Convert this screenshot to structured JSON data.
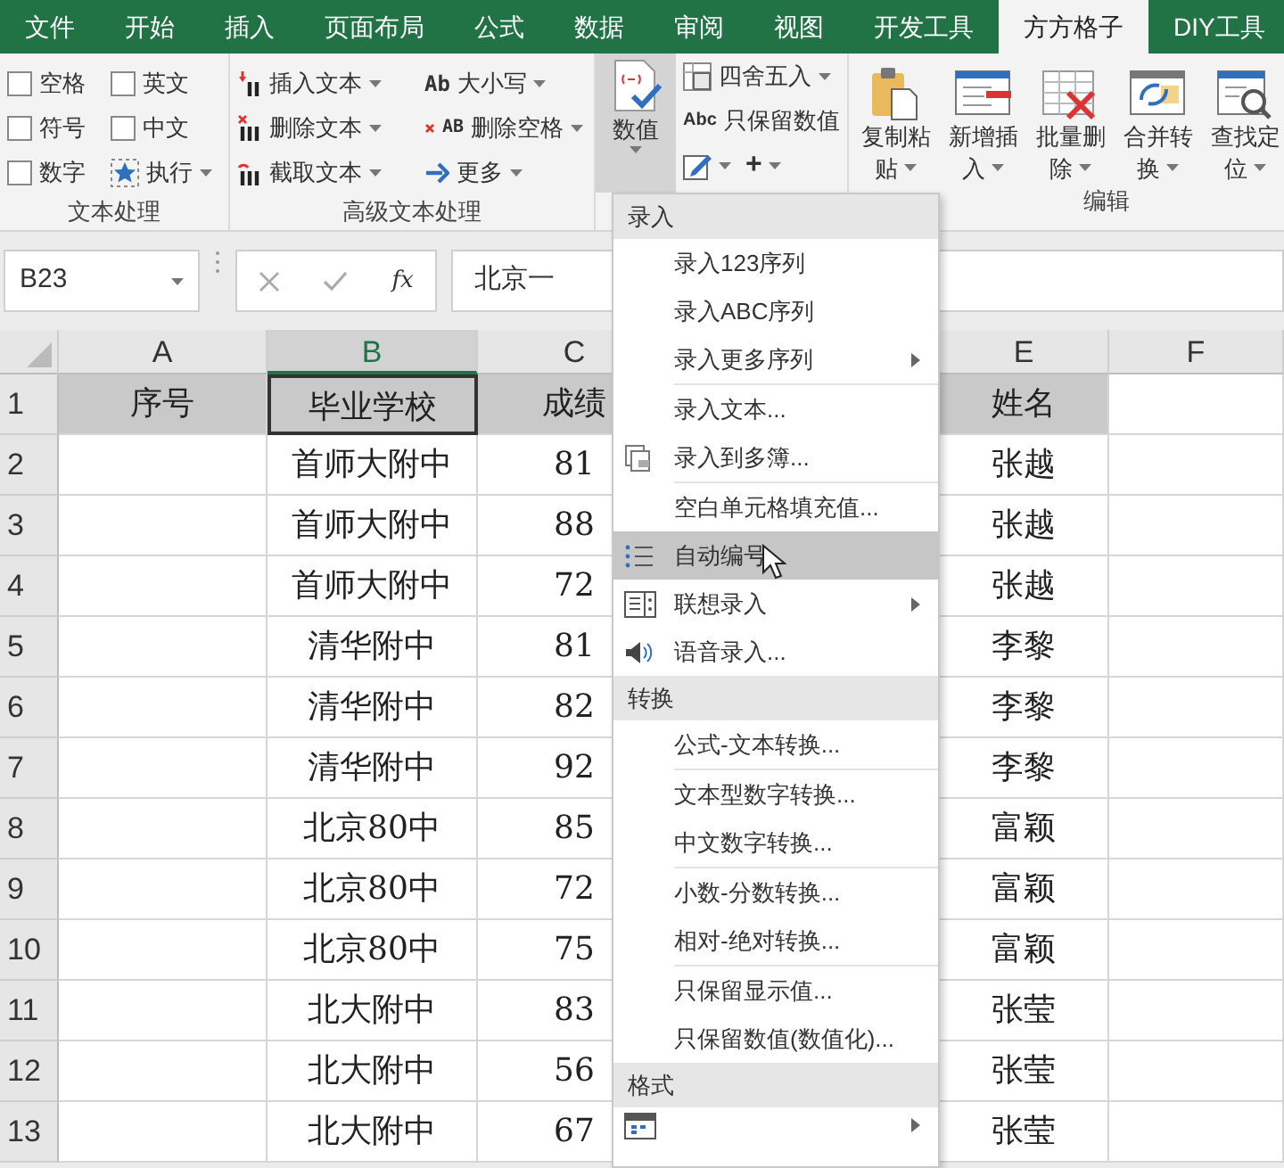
{
  "tabs": [
    {
      "label": "文件",
      "selected": false
    },
    {
      "label": "开始",
      "selected": false
    },
    {
      "label": "插入",
      "selected": false
    },
    {
      "label": "页面布局",
      "selected": false
    },
    {
      "label": "公式",
      "selected": false
    },
    {
      "label": "数据",
      "selected": false
    },
    {
      "label": "审阅",
      "selected": false
    },
    {
      "label": "视图",
      "selected": false
    },
    {
      "label": "开发工具",
      "selected": false
    },
    {
      "label": "方方格子",
      "selected": true
    },
    {
      "label": "DIY工具",
      "selected": false
    }
  ],
  "ribbon": {
    "text_group": {
      "label": "文本处理",
      "checkboxes": [
        {
          "label": "空格",
          "checked": false
        },
        {
          "label": "英文",
          "checked": false
        },
        {
          "label": "符号",
          "checked": false
        },
        {
          "label": "中文",
          "checked": false
        },
        {
          "label": "数字",
          "checked": false
        }
      ],
      "execute": "执行"
    },
    "advanced_group": {
      "label": "高级文本处理",
      "buttons": [
        {
          "label": "插入文本"
        },
        {
          "label": "大小写",
          "icon_text": "Ab"
        },
        {
          "label": "删除文本"
        },
        {
          "label": "删除空格",
          "icon_text": "AB"
        },
        {
          "label": "截取文本"
        },
        {
          "label": "更多"
        }
      ]
    },
    "number_group": {
      "button": "数值",
      "pressed": true,
      "round": "四舍五入",
      "keep": "只保留数值",
      "keep_icon_text": "Abc",
      "plus": "+"
    },
    "edit_group": {
      "label": "编辑",
      "buttons": [
        {
          "lines": [
            "复制粘",
            "贴"
          ]
        },
        {
          "lines": [
            "新增插",
            "入"
          ]
        },
        {
          "lines": [
            "批量删",
            "除"
          ]
        },
        {
          "lines": [
            "合并转",
            "换"
          ]
        },
        {
          "lines": [
            "查找定",
            "位"
          ]
        }
      ]
    }
  },
  "formula_bar": {
    "name_box": "B23",
    "fx": "fx",
    "value": "北京一"
  },
  "grid": {
    "columns": [
      {
        "label": "A",
        "selected": false
      },
      {
        "label": "B",
        "selected": true
      },
      {
        "label": "C",
        "selected": false
      },
      {
        "label": "E",
        "selected": false
      },
      {
        "label": "F",
        "selected": false
      }
    ],
    "rows": [
      {
        "number": "1",
        "header": true,
        "cells": [
          "序号",
          "毕业学校",
          "成绩",
          "姓名",
          null
        ]
      },
      {
        "number": "2",
        "header": false,
        "cells": [
          null,
          "首师大附中",
          "81",
          "张越",
          null
        ]
      },
      {
        "number": "3",
        "header": false,
        "cells": [
          null,
          "首师大附中",
          "88",
          "张越",
          null
        ]
      },
      {
        "number": "4",
        "header": false,
        "cells": [
          null,
          "首师大附中",
          "72",
          "张越",
          null
        ]
      },
      {
        "number": "5",
        "header": false,
        "cells": [
          null,
          "清华附中",
          "81",
          "李黎",
          null
        ]
      },
      {
        "number": "6",
        "header": false,
        "cells": [
          null,
          "清华附中",
          "82",
          "李黎",
          null
        ]
      },
      {
        "number": "7",
        "header": false,
        "cells": [
          null,
          "清华附中",
          "92",
          "李黎",
          null
        ]
      },
      {
        "number": "8",
        "header": false,
        "cells": [
          null,
          "北京80中",
          "85",
          "富颖",
          null
        ]
      },
      {
        "number": "9",
        "header": false,
        "cells": [
          null,
          "北京80中",
          "72",
          "富颖",
          null
        ]
      },
      {
        "number": "10",
        "header": false,
        "cells": [
          null,
          "北京80中",
          "75",
          "富颖",
          null
        ]
      },
      {
        "number": "11",
        "header": false,
        "cells": [
          null,
          "北大附中",
          "83",
          "张莹",
          null
        ]
      },
      {
        "number": "12",
        "header": false,
        "cells": [
          null,
          "北大附中",
          "56",
          "张莹",
          null
        ]
      },
      {
        "number": "13",
        "header": false,
        "cells": [
          null,
          "北大附中",
          "67",
          "张莹",
          null
        ]
      }
    ]
  },
  "menu": {
    "sections": [
      {
        "title": "录入",
        "items": [
          {
            "kind": "item",
            "label": "录入123序列",
            "submenu": false,
            "selected": false
          },
          {
            "kind": "item",
            "label": "录入ABC序列",
            "submenu": false,
            "selected": false
          },
          {
            "kind": "item",
            "label": "录入更多序列",
            "submenu": true,
            "selected": false
          },
          {
            "kind": "separator"
          },
          {
            "kind": "item",
            "label": "录入文本...",
            "submenu": false,
            "selected": false
          },
          {
            "kind": "copy",
            "label": "录入到多簿...",
            "submenu": false,
            "selected": false
          },
          {
            "kind": "separator"
          },
          {
            "kind": "item",
            "label": "空白单元格填充值...",
            "submenu": false,
            "selected": false
          },
          {
            "kind": "list",
            "label": "自动编号",
            "submenu": false,
            "selected": true
          },
          {
            "kind": "panel",
            "label": "联想录入",
            "submenu": true,
            "selected": false
          },
          {
            "kind": "speaker",
            "label": "语音录入...",
            "submenu": false,
            "selected": false
          }
        ]
      },
      {
        "title": "转换",
        "items": [
          {
            "kind": "item",
            "label": "公式-文本转换...",
            "submenu": false,
            "selected": false
          },
          {
            "kind": "separator"
          },
          {
            "kind": "item",
            "label": "文本型数字转换...",
            "submenu": false,
            "selected": false
          },
          {
            "kind": "item",
            "label": "中文数字转换...",
            "submenu": false,
            "selected": false
          },
          {
            "kind": "separator"
          },
          {
            "kind": "item",
            "label": "小数-分数转换...",
            "submenu": false,
            "selected": false
          },
          {
            "kind": "item",
            "label": "相对-绝对转换...",
            "submenu": false,
            "selected": false
          },
          {
            "kind": "separator"
          },
          {
            "kind": "item",
            "label": "只保留显示值...",
            "submenu": false,
            "selected": false
          },
          {
            "kind": "item",
            "label": "只保留数值(数值化)...",
            "submenu": false,
            "selected": false
          }
        ]
      },
      {
        "title": "格式",
        "items": [
          {
            "kind": "calendar-cut",
            "submenu": true,
            "selected": false
          }
        ]
      }
    ]
  }
}
